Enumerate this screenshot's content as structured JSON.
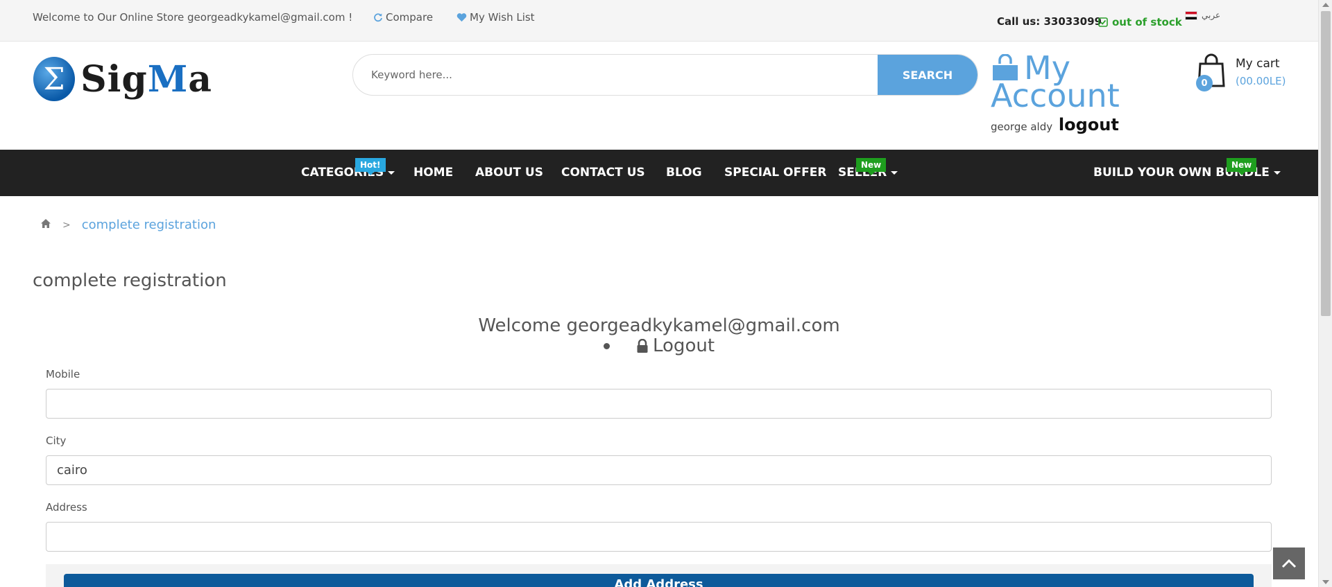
{
  "topbar": {
    "welcome": "Welcome to Our Online Store georgeadkykamel@gmail.com !",
    "compare": "Compare",
    "wishlist": "My Wish List",
    "call_us": "Call us: 33033099",
    "stock": "out of stock",
    "language": "عربي"
  },
  "header": {
    "logo_text_a": "Sig",
    "logo_text_b": "M",
    "logo_text_c": "a",
    "logo_symbol": "Σ",
    "search_placeholder": "Keyword here...",
    "search_button": "SEARCH",
    "account_title": "My Account",
    "user_name": "george aldy",
    "logout_link": "logout",
    "cart_label": "My cart",
    "cart_count": "0",
    "cart_amount": "(00.00LE)"
  },
  "nav": {
    "items": [
      {
        "label": "CATEGORIES",
        "badge": "Hot!"
      },
      {
        "label": "HOME"
      },
      {
        "label": "ABOUT US"
      },
      {
        "label": "CONTACT US"
      },
      {
        "label": "BLOG"
      },
      {
        "label": "SPECIAL OFFER"
      },
      {
        "label": "SELLER",
        "badge": "New"
      },
      {
        "label": "BUILD YOUR OWN BUNDLE",
        "badge": "New"
      }
    ]
  },
  "breadcrumb": {
    "separator": ">",
    "current": "complete registration"
  },
  "main": {
    "page_title": "complete registration",
    "welcome": "Welcome georgeadkykamel@gmail.com",
    "logout": "Logout",
    "fields": [
      {
        "label": "Mobile",
        "value": ""
      },
      {
        "label": "City",
        "value": "cairo"
      },
      {
        "label": "Address",
        "value": ""
      }
    ],
    "add_address_button": "Add Address"
  },
  "colors": {
    "accent": "#5ba3dd",
    "nav_bg": "#222222",
    "stock_green": "#2ca02c",
    "button_blue": "#0d5a9a"
  },
  "icons": [
    "refresh-icon",
    "heart-icon",
    "check-square-icon",
    "flag-icon",
    "bag-icon",
    "cart-bag-icon",
    "home-icon",
    "lock-icon",
    "chevron-up-icon"
  ]
}
